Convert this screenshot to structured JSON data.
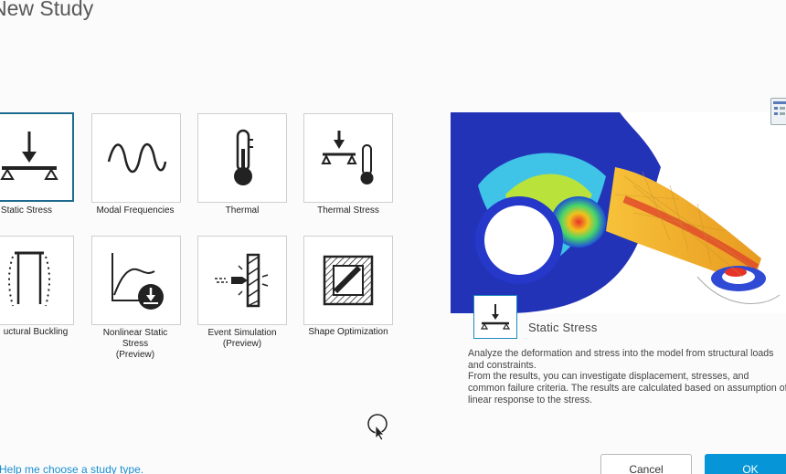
{
  "dialog": {
    "title": "New Study"
  },
  "study_types": [
    {
      "label": "Static Stress",
      "icon": "static-stress-icon",
      "selected": true
    },
    {
      "label": "Modal Frequencies",
      "icon": "sine-wave-icon"
    },
    {
      "label": "Thermal",
      "icon": "thermometer-icon"
    },
    {
      "label": "Thermal Stress",
      "icon": "thermal-stress-icon"
    },
    {
      "label": "uctural Buckling",
      "icon": "buckling-icon"
    },
    {
      "label": "Nonlinear Static\nStress\n(Preview)",
      "icon": "nonlinear-curve-icon"
    },
    {
      "label": "Event Simulation\n(Preview)",
      "icon": "impact-icon"
    },
    {
      "label": "Shape Optimization",
      "icon": "shape-optimization-icon"
    }
  ],
  "details": {
    "name": "Static Stress",
    "description": "Analyze the deformation and stress into the model from structural loads and constraints.\nFrom the results, you can investigate displacement, stresses, and common failure criteria. The results are calculated based on assumption of linear response to the stress."
  },
  "footer": {
    "help_link": "Help me choose a study type.",
    "cancel_label": "Cancel",
    "ok_label": "OK"
  },
  "colors": {
    "accent": "#0696d7",
    "selected_border": "#1d6b8e",
    "link": "#1a8fd0"
  }
}
